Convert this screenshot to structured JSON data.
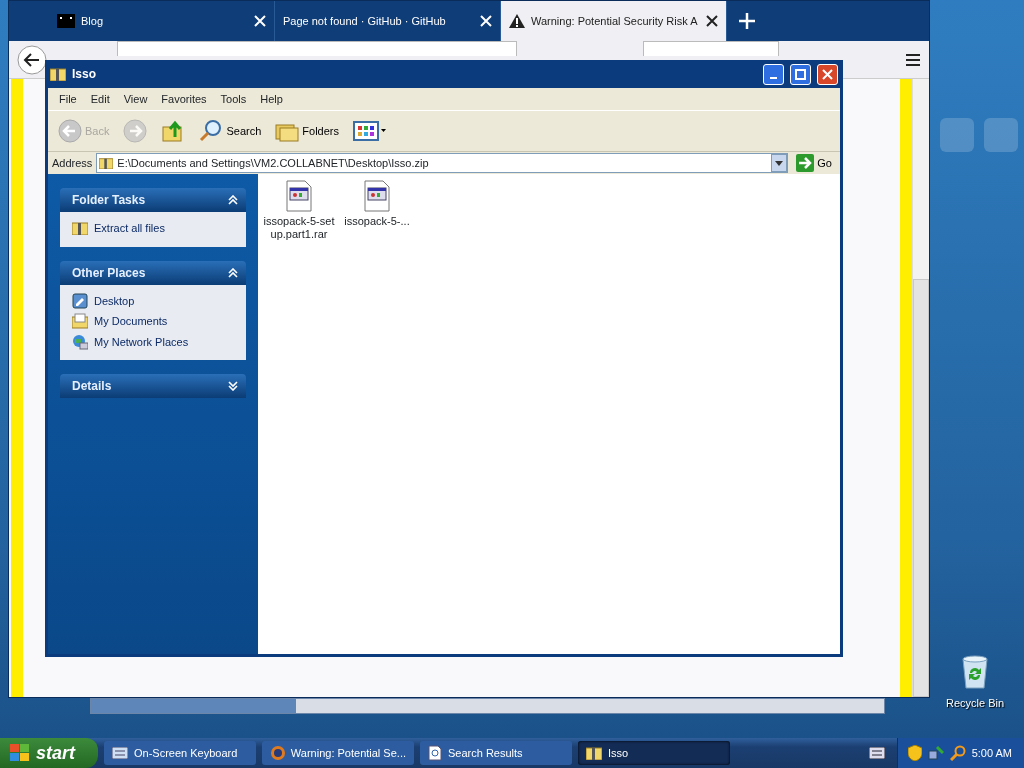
{
  "browser": {
    "tabs": [
      {
        "label": "Blog",
        "kind": "site",
        "selected": false
      },
      {
        "label": "Page not found · GitHub · GitHub",
        "kind": "plain",
        "selected": false
      },
      {
        "label": "Warning: Potential Security Risk A",
        "kind": "warning",
        "selected": true
      }
    ],
    "url_field": {
      "disabled": false
    },
    "search_field": {
      "disabled": false
    }
  },
  "explorer": {
    "title": "Isso",
    "menu": [
      "File",
      "Edit",
      "View",
      "Favorites",
      "Tools",
      "Help"
    ],
    "toolbar": {
      "back": {
        "label": "Back",
        "disabled": true
      },
      "forward": {
        "disabled": true
      },
      "search": "Search",
      "folders": "Folders"
    },
    "address": {
      "label": "Address",
      "value": "E:\\Documents and Settings\\VM2.COLLABNET\\Desktop\\Isso.zip",
      "go": "Go"
    },
    "panels": [
      {
        "title": "Folder Tasks",
        "expanded": true,
        "items": [
          {
            "label": "Extract all files",
            "kind": "zip"
          }
        ]
      },
      {
        "title": "Other Places",
        "expanded": true,
        "items": [
          {
            "label": "Desktop",
            "kind": "desktop"
          },
          {
            "label": "My Documents",
            "kind": "documents"
          },
          {
            "label": "My Network Places",
            "kind": "network"
          }
        ]
      },
      {
        "title": "Details",
        "expanded": false
      }
    ],
    "files": [
      {
        "name": "issopack-5-setup.part1.rar"
      },
      {
        "name": "issopack-5-..."
      }
    ]
  },
  "desktop": {
    "icons": [
      {
        "label": "Recycle Bin"
      }
    ]
  },
  "taskbar": {
    "start": "start",
    "tasks": [
      {
        "label": "On-Screen Keyboard",
        "kind": "keyboard",
        "selected": false
      },
      {
        "label": "Warning: Potential Se...",
        "kind": "browser",
        "selected": false
      },
      {
        "label": "Search Results",
        "kind": "search",
        "selected": false
      },
      {
        "label": "Isso",
        "kind": "zip",
        "selected": true
      }
    ],
    "clock": "5:00 AM"
  }
}
